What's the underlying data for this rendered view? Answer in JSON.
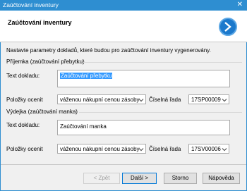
{
  "window": {
    "title": "Zaúčtování inventury",
    "close_glyph": "✕"
  },
  "header": {
    "title": "Zaúčtování inventury",
    "logo_icon": "arrow-right-circle-icon"
  },
  "intro": "Nastavte parametry dokladů, které budou pro zaúčtování inventury vygenerovány.",
  "prijemka": {
    "section_label": "Příjemka (zaúčtování přebytku)",
    "text_label": "Text dokladu:",
    "text_value": "Zaúčtování přebytku",
    "items_label": "Položky ocenit",
    "items_value": "váženou nákupní cenou zásoby",
    "series_label": "Číselná řada",
    "series_value": "17SP00009"
  },
  "vydejka": {
    "section_label": "Výdejka (zaúčtování manka)",
    "text_label": "Text dokladu:",
    "text_value": "Zaúčtování manka",
    "items_label": "Položky ocenit",
    "items_value": "váženou nákupní cenou zásoby",
    "series_label": "Číselná řada",
    "series_value": "17SV00006"
  },
  "buttons": {
    "back": "< Zpět",
    "next": "Další >",
    "cancel": "Storno",
    "help": "Nápověda"
  },
  "colors": {
    "titlebar": "#2e8ed1",
    "selection": "#3399ff",
    "logo": "#1c79cc"
  }
}
